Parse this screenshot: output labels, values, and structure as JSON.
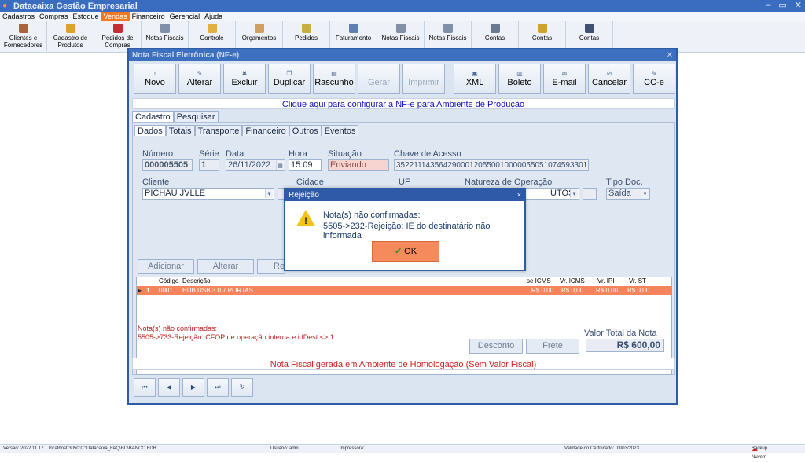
{
  "app_title": "Datacaixa Gestão Empresarial",
  "window_controls": [
    "–",
    "▭",
    "✕"
  ],
  "menu": [
    "Cadastros",
    "Compras",
    "Estoque",
    "Vendas",
    "Financeiro",
    "Gerencial",
    "Ajuda"
  ],
  "menu_active": "Vendas",
  "ribbon": [
    {
      "label": "Clientes e Fornecedores",
      "icon": "people-icon"
    },
    {
      "label": "Cadastro de Produtos",
      "icon": "box-icon"
    },
    {
      "label": "Pedidos de Compras",
      "icon": "book-icon"
    },
    {
      "label": "Notas Fiscais",
      "icon": "document-icon"
    },
    {
      "label": "Controle",
      "icon": "folder-icon"
    },
    {
      "label": "Orçamentos",
      "icon": "quote-icon"
    },
    {
      "label": "Pedidos",
      "icon": "order-icon"
    },
    {
      "label": "Faturamento",
      "icon": "invoice-icon"
    },
    {
      "label": "Notas Fiscais",
      "icon": "document-icon"
    },
    {
      "label": "Notas Fiscais",
      "icon": "document-icon"
    },
    {
      "label": "Contas",
      "icon": "wallet-icon"
    },
    {
      "label": "Contas",
      "icon": "money-icon"
    },
    {
      "label": "Contas",
      "icon": "archive-icon"
    }
  ],
  "nfe": {
    "window_title": "Nota Fiscal Eletrônica (NF-e)",
    "toolbar": [
      {
        "label": "Novo",
        "u": "N",
        "enabled": true
      },
      {
        "label": "Alterar",
        "u": "A",
        "enabled": true
      },
      {
        "label": "Excluir",
        "u": "E",
        "enabled": true
      },
      {
        "label": "Duplicar",
        "u": "",
        "enabled": true
      },
      {
        "label": "Rascunho",
        "u": "",
        "enabled": true
      },
      {
        "label": "Gerar",
        "u": "",
        "enabled": false
      },
      {
        "label": "Imprimir",
        "u": "",
        "enabled": false
      },
      {
        "label": "XML",
        "u": "",
        "enabled": true
      },
      {
        "label": "Boleto",
        "u": "",
        "enabled": true
      },
      {
        "label": "E-mail",
        "u": "",
        "enabled": true
      },
      {
        "label": "Cancelar",
        "u": "",
        "enabled": true
      },
      {
        "label": "CC-e",
        "u": "",
        "enabled": true
      }
    ],
    "config_link": "Clique aqui para configurar a NF-e para Ambiente de Produção",
    "main_tabs": [
      "Cadastro",
      "Pesquisar"
    ],
    "sub_tabs": [
      "Dados",
      "Totais",
      "Transporte",
      "Financeiro",
      "Outros",
      "Eventos"
    ],
    "fields": {
      "numero_label": "Número",
      "numero": "000005505",
      "serie_label": "Série",
      "serie": "1",
      "data_label": "Data",
      "data": "26/11/2022",
      "hora_label": "Hora",
      "hora": "15:09",
      "situacao_label": "Situação",
      "situacao": "Enviando",
      "chave_label": "Chave de Acesso",
      "chave": "35221114356429000120550010000055051074593301",
      "cliente_label": "Cliente",
      "cliente": "PICHAU JVLLE",
      "cidade_label": "Cidade",
      "uf_label": "UF",
      "natureza_label": "Natureza de Operação",
      "natureza": "UTOS",
      "tipo_doc_label": "Tipo Doc.",
      "tipo_doc": "Saída"
    },
    "grid_buttons": [
      "Adicionar",
      "Alterar",
      "Re"
    ],
    "grid_columns": [
      "Código",
      "Descrição",
      "se ICMS",
      "Vr. ICMS",
      "Vr. IPI",
      "Vr. ST"
    ],
    "grid_rows": [
      {
        "n": "1",
        "codigo": "0001",
        "descricao": "HUB USB 3.0 7 PORTAS",
        "base_icms": "R$ 0,00",
        "vr_icms": "R$ 0,00",
        "vr_ipi": "R$ 0,00",
        "vr_st": "R$ 0,00"
      }
    ],
    "errors_title": "Nota(s) não confirmadas:",
    "errors": "5505->733-Rejeição: CFOP de operação interna e idDest <> 1",
    "desconto_label": "Desconto",
    "frete_label": "Frete",
    "total_label": "Valor Total da Nota",
    "total": "R$ 600,00",
    "footer_message": "Nota Fiscal gerada em Ambiente de Homologação (Sem Valor Fiscal)",
    "nav_buttons": [
      "⏮",
      "◀",
      "▶",
      "⏭",
      "↻"
    ]
  },
  "dialog": {
    "title": "Rejeição",
    "line1": "Nota(s) não confirmadas:",
    "line2": "5505->232-Rejeição: IE do destinatário não informada",
    "ok_label": "OK",
    "close": "×"
  },
  "status": {
    "versao": "Versão: 2022.11.17",
    "banco": "localhost/3050:C:\\Datacaixa_FAQ\\BD\\BANCO.FDB",
    "usuario": "Usuário: adm",
    "impressora": "Impressora:",
    "certificado": "Validade do Certificado: 03/03/2023",
    "backup": "Backup Nuvem"
  }
}
